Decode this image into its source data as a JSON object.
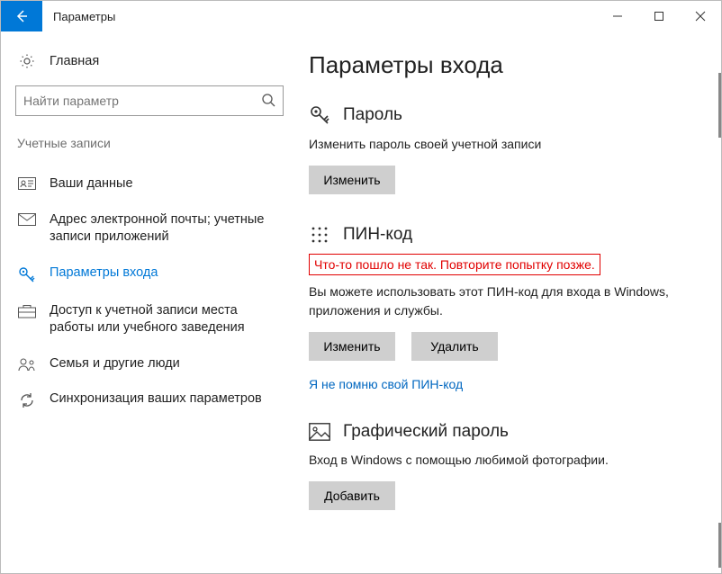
{
  "window": {
    "title": "Параметры"
  },
  "sidebar": {
    "home": "Главная",
    "search_placeholder": "Найти параметр",
    "section": "Учетные записи",
    "items": [
      {
        "label": "Ваши данные"
      },
      {
        "label": "Адрес электронной почты; учетные записи приложений"
      },
      {
        "label": "Параметры входа"
      },
      {
        "label": "Доступ к учетной записи места работы или учебного заведения"
      },
      {
        "label": "Семья и другие люди"
      },
      {
        "label": "Синхронизация ваших параметров"
      }
    ]
  },
  "main": {
    "title": "Параметры входа",
    "password": {
      "heading": "Пароль",
      "desc": "Изменить пароль своей учетной записи",
      "change_btn": "Изменить"
    },
    "pin": {
      "heading": "ПИН-код",
      "error": "Что-то пошло не так. Повторите попытку позже.",
      "desc": "Вы можете использовать этот ПИН-код для входа в Windows, приложения и службы.",
      "change_btn": "Изменить",
      "delete_btn": "Удалить",
      "forgot": "Я не помню свой ПИН-код"
    },
    "picture": {
      "heading": "Графический пароль",
      "desc": "Вход в Windows с помощью любимой фотографии.",
      "add_btn": "Добавить"
    }
  }
}
